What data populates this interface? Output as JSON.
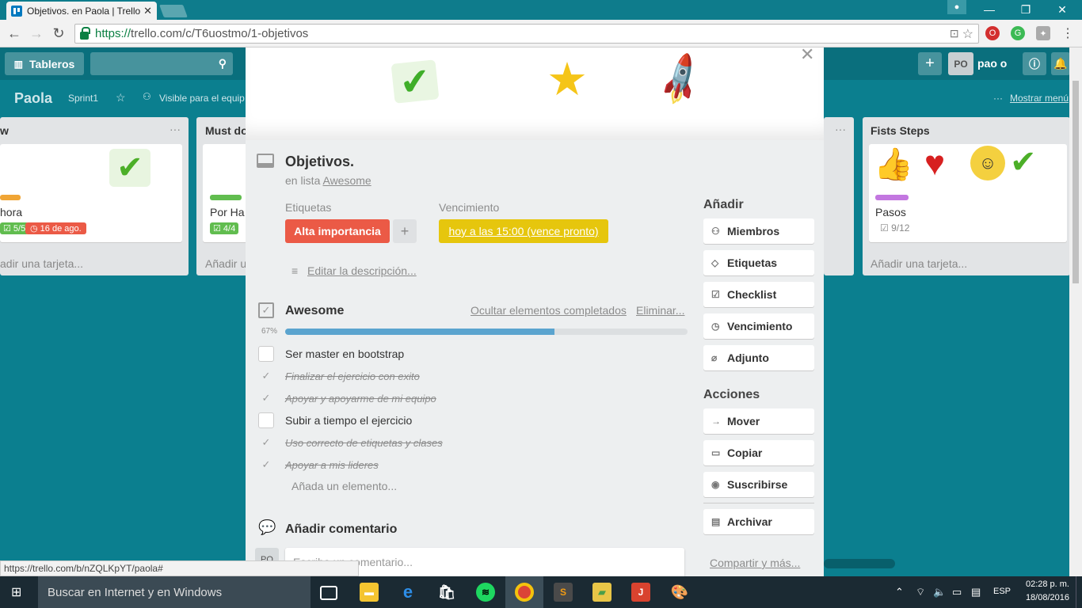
{
  "browser": {
    "tab_title": "Objetivos. en Paola | Trello",
    "url_scheme": "https://",
    "url_rest": "trello.com/c/T6uostmo/1-objetivos",
    "status_url": "https://trello.com/b/nZQLKpYT/paola#"
  },
  "header": {
    "boards_label": "Tableros",
    "avatar_initials": "PO",
    "user_name": "pao o"
  },
  "board": {
    "name": "Paola",
    "sprint": "Sprint1",
    "visibility": "Visible para el equip",
    "menu": "Mostrar menú"
  },
  "lists": {
    "left": {
      "title": "w",
      "card_title": "hora",
      "badge1": "5/5",
      "badge2": "16 de ago.",
      "add": "adir una tarjeta..."
    },
    "must": {
      "title": "Must do",
      "card_title": "Por Ha",
      "badge1": "4/4",
      "add": "Añadir u"
    },
    "fists": {
      "title": "Fists Steps",
      "card_title": "Pasos",
      "badge1": "9/12",
      "add": "Añadir una tarjeta..."
    }
  },
  "card": {
    "title": "Objetivos.",
    "in_list_prefix": "en lista",
    "list_name": "Awesome",
    "labels_heading": "Etiquetas",
    "label": "Alta importancia",
    "add_label": "+",
    "due_heading": "Vencimiento",
    "due": "hoy a las 15:00 (vence pronto)",
    "edit_description": "Editar la descripción...",
    "checklist": {
      "title": "Awesome",
      "hide_completed": "Ocultar elementos completados",
      "delete": "Eliminar...",
      "progress_label": "67%",
      "progress": 0.67,
      "items": [
        {
          "text": "Ser master en bootstrap",
          "done": false
        },
        {
          "text": "Finalizar el ejercicio con exito",
          "done": true
        },
        {
          "text": "Apoyar y apoyarme de mi equipo",
          "done": true
        },
        {
          "text": "Subir a tiempo el ejercicio",
          "done": false
        },
        {
          "text": "Uso correcto de etiquetas y clases",
          "done": true
        },
        {
          "text": "Apoyar a mis lideres",
          "done": true
        }
      ],
      "add_item": "Añada un elemento..."
    },
    "comment_heading": "Añadir comentario",
    "comment_placeholder": "Escriba un comentario...",
    "comment_avatar": "PO"
  },
  "sidebar": {
    "add_heading": "Añadir",
    "add_buttons": [
      "Miembros",
      "Etiquetas",
      "Checklist",
      "Vencimiento",
      "Adjunto"
    ],
    "actions_heading": "Acciones",
    "action_buttons": [
      "Mover",
      "Copiar",
      "Suscribirse",
      "Archivar"
    ],
    "share": "Compartir y más..."
  },
  "taskbar": {
    "search_placeholder": "Buscar en Internet y en Windows",
    "lang": "ESP",
    "time": "02:28 p. m.",
    "date": "18/08/2016"
  },
  "colors": {
    "label_red": "#eb5a46",
    "due_yellow": "#e6c60d",
    "progress_blue": "#5ba4cf",
    "board_bg": "#0b7f8f"
  }
}
